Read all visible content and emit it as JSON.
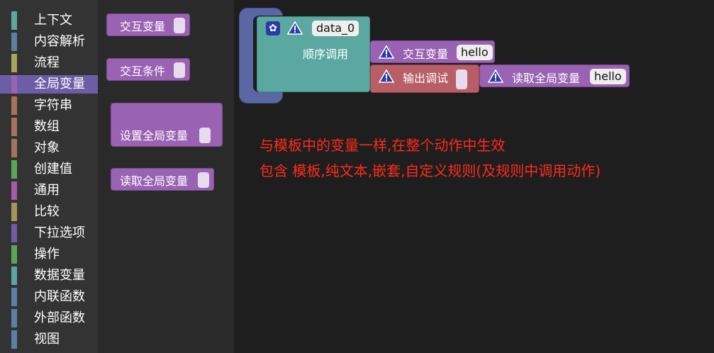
{
  "toolbox": {
    "categories": [
      {
        "label": "上下文",
        "color": "#5aa89f"
      },
      {
        "label": "内容解析",
        "color": "#5b80a5"
      },
      {
        "label": "流程",
        "color": "#a5a55b"
      },
      {
        "label": "全局变量",
        "color": "#9a62b2"
      },
      {
        "label": "字符串",
        "color": "#a5745b"
      },
      {
        "label": "数组",
        "color": "#a5745b"
      },
      {
        "label": "对象",
        "color": "#a5745b"
      },
      {
        "label": "创建值",
        "color": "#5ba55b"
      },
      {
        "label": "通用",
        "color": "#a55ba5"
      },
      {
        "label": "比较",
        "color": "#a5955b"
      },
      {
        "label": "下拉选项",
        "color": "#745ba5"
      },
      {
        "label": "操作",
        "color": "#5ba55b"
      },
      {
        "label": "数据变量",
        "color": "#5ba5a5"
      },
      {
        "label": "内联函数",
        "color": "#5b80a5"
      },
      {
        "label": "外部函数",
        "color": "#5b80a5"
      },
      {
        "label": "视图",
        "color": "#5b80a5"
      }
    ],
    "selected_index": 3
  },
  "flyout": {
    "blocks": [
      {
        "label": "交互变量"
      },
      {
        "label": "交互条件"
      },
      {
        "label": "设置全局变量"
      },
      {
        "label": "读取全局变量"
      }
    ]
  },
  "workspace": {
    "main_block": {
      "name": "data_0",
      "statement_label": "顺序调用"
    },
    "interact_block": {
      "label": "交互变量",
      "value": "hello"
    },
    "output_block": {
      "label": "输出调试"
    },
    "read_block": {
      "label": "读取全局变量",
      "value": "hello"
    },
    "note_line1": "与模板中的变量一样,在整个动作中生效",
    "note_line2": "包含 模板,纯文本,嵌套,自定义规则(及规则中调用动作)"
  }
}
